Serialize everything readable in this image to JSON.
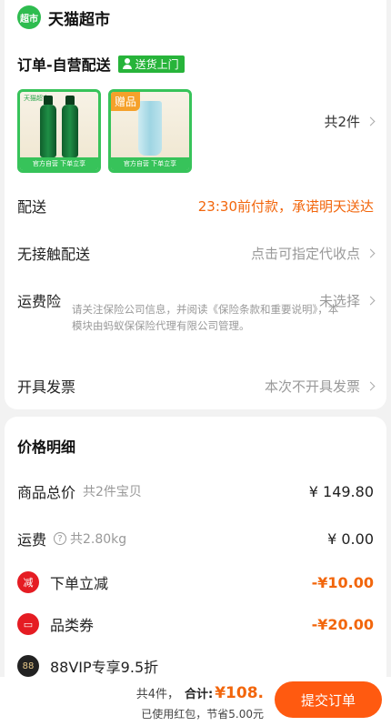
{
  "shop": {
    "logo_text": "超市",
    "name": "天猫超市"
  },
  "order": {
    "title": "订单-自营配送",
    "delivery_tag": "送货上门",
    "item_count": "共2件"
  },
  "thumbs": {
    "gift_badge": "赠品",
    "brand": "天猫超市",
    "strip_text": "官方自营 下单立享"
  },
  "rows": {
    "delivery_label": "配送",
    "delivery_value": "23:30前付款，承诺明天送达",
    "contactless_label": "无接触配送",
    "contactless_value": "点击可指定代收点",
    "insurance_label": "运费险",
    "insurance_value": "未选择",
    "insurance_note": "请关注保险公司信息，并阅读《保险条款和重要说明》，本模块由蚂蚁保保险代理有限公司管理。",
    "invoice_label": "开具发票",
    "invoice_value": "本次不开具发票"
  },
  "price": {
    "title": "价格明细",
    "goods_label": "商品总价",
    "goods_sub": "共2件宝贝",
    "goods_amount": "¥ 149.80",
    "shipping_label": "运费",
    "shipping_sub": "共2.80kg",
    "shipping_amount": "¥ 0.00",
    "instant_label": "下单立减",
    "instant_icon": "减",
    "instant_amount": "-¥10.00",
    "coupon_label": "品类券",
    "coupon_amount": "-¥20.00",
    "vip_icon": "88",
    "vip_label": "88VIP专享9.5折"
  },
  "bottom": {
    "count": "共4件，",
    "sum_label": "合计:",
    "sum_value": "¥108.",
    "saved": "已使用红包，节省5.00元",
    "submit": "提交订单"
  },
  "colors": {
    "accent_green": "#27b43a",
    "accent_orange": "#f2660c",
    "submit_orange": "#ff5a10"
  }
}
